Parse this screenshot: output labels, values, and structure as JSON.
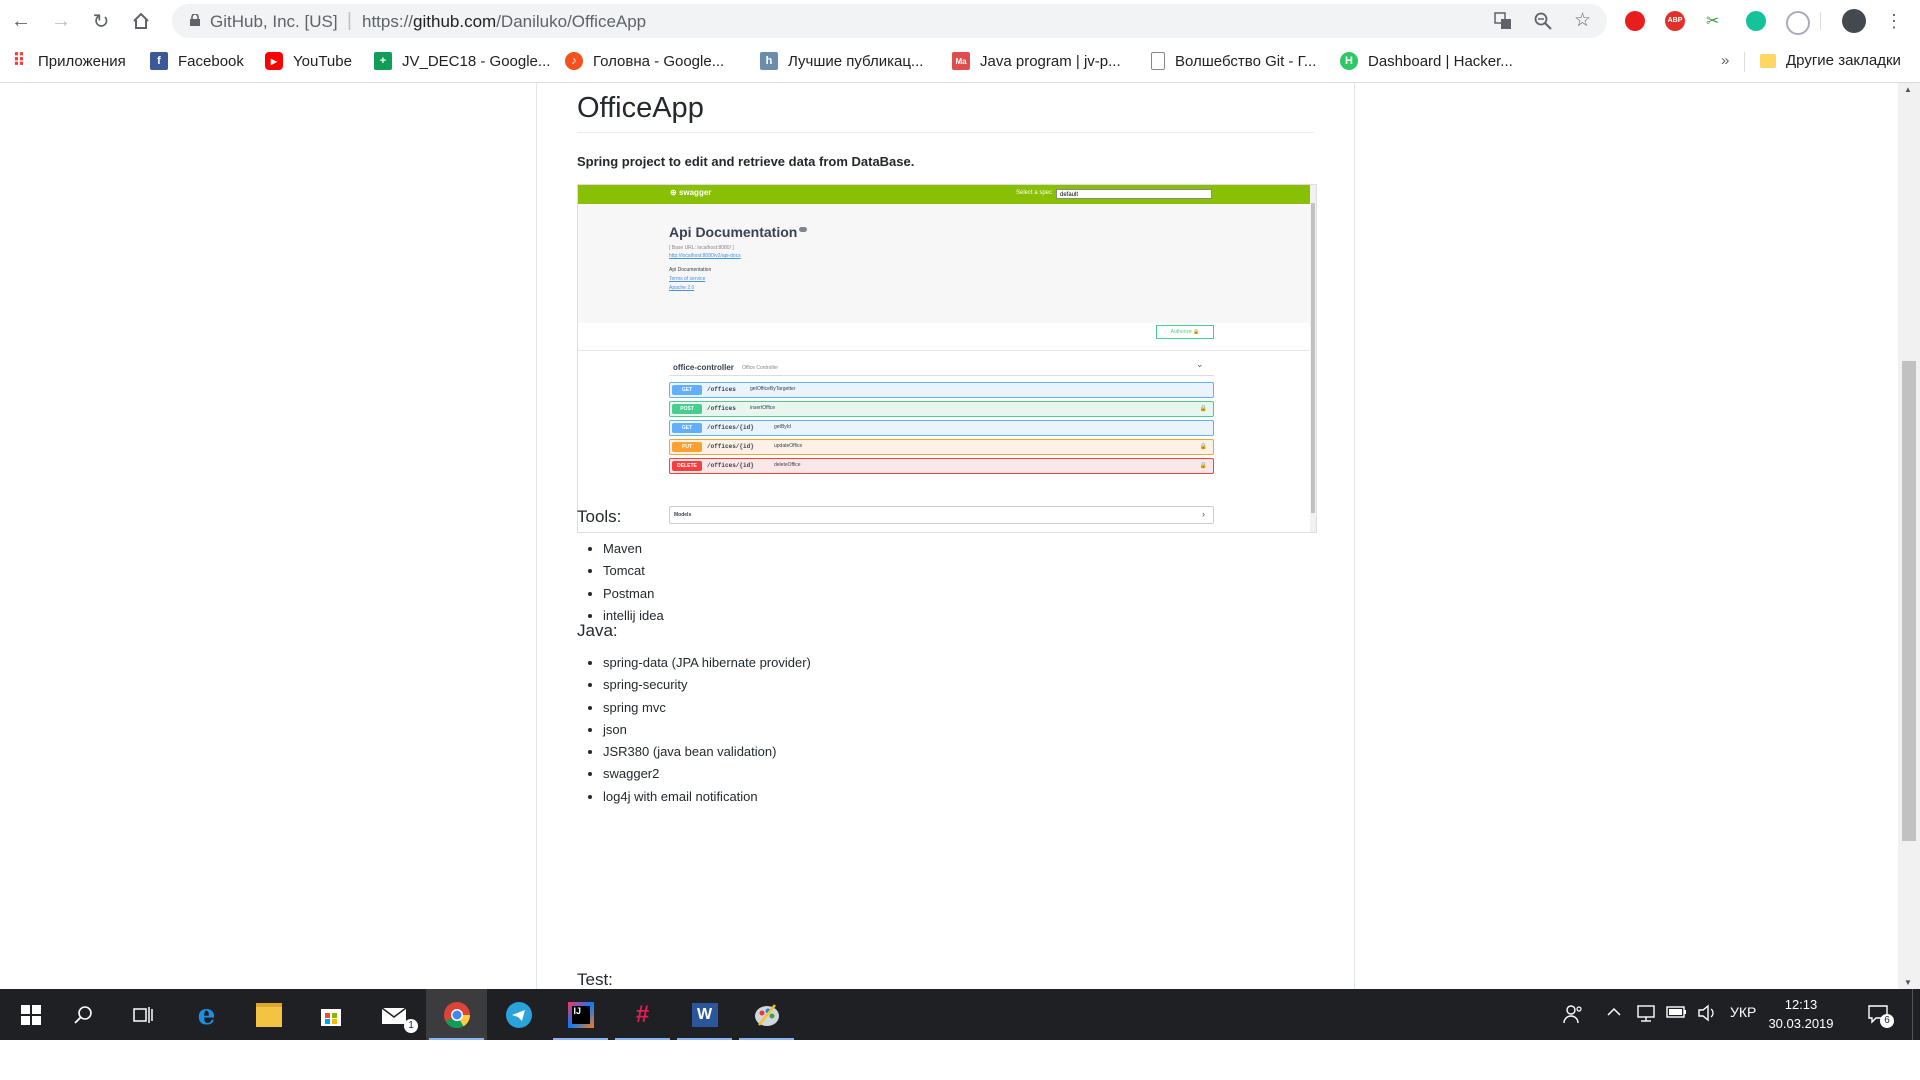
{
  "browser": {
    "site_identity": "GitHub, Inc. [US]",
    "url_prefix": "https://",
    "url_host": "github.com",
    "url_path": "/Daniluko/OfficeApp",
    "bookmarks": [
      {
        "label": "Приложения",
        "icon": "apps-grid-icon",
        "color": "#ea4335"
      },
      {
        "label": "Facebook",
        "icon": "facebook-icon",
        "color": "#3b5998"
      },
      {
        "label": "YouTube",
        "icon": "youtube-icon",
        "color": "#ff0000"
      },
      {
        "label": "JV_DEC18 - Google...",
        "icon": "google-sheets-icon",
        "color": "#0f9d58"
      },
      {
        "label": "Головна - Google...",
        "icon": "google-site-icon",
        "color": "#f4511e"
      },
      {
        "label": "Лучшие публикац...",
        "icon": "habr-icon",
        "color": "#6b8cab"
      },
      {
        "label": "Java program | jv-p...",
        "icon": "mate-icon",
        "color": "#e04b4b"
      },
      {
        "label": "Волшебство Git - Г...",
        "icon": "page-icon",
        "color": "#888888"
      },
      {
        "label": "Dashboard | Hacker...",
        "icon": "hackerrank-icon",
        "color": "#2ec866"
      }
    ],
    "more_bookmarks": "»",
    "other_bookmarks": "Другие закладки"
  },
  "readme": {
    "title": "OfficeApp",
    "description": "Spring project to edit and retrieve data from DataBase.",
    "swagger": {
      "logo": "swagger",
      "select_label": "Select a spec",
      "select_value": "default",
      "title": "Api Documentation",
      "base_url": "[ Base URL: localhost:8080/ ]",
      "docs_link": "http://localhost:8080/v2/api-docs",
      "info_text": "Api Documentation",
      "terms_link": "Terms of service",
      "license_link": "Apache 2.0",
      "authorize": "Authorize",
      "controller": "office-controller",
      "controller_desc": "Office Controller",
      "operations": [
        {
          "method": "GET",
          "path": "/offices",
          "summary": "getOfficeByTargetter",
          "color": "#61affe",
          "bg": "#ebf3fb",
          "locked": false
        },
        {
          "method": "POST",
          "path": "/offices",
          "summary": "insertOffice",
          "color": "#49cc90",
          "bg": "#e8f6f0",
          "locked": true
        },
        {
          "method": "GET",
          "path": "/offices/{id}",
          "summary": "getById",
          "color": "#61affe",
          "bg": "#ebf3fb",
          "locked": false
        },
        {
          "method": "PUT",
          "path": "/offices/{id}",
          "summary": "updateOffice",
          "color": "#fca130",
          "bg": "#fbf1e6",
          "locked": true
        },
        {
          "method": "DELETE",
          "path": "/offices/{id}",
          "summary": "deleteOffice",
          "color": "#f93e3e",
          "bg": "#fae7e7",
          "locked": true
        }
      ],
      "models": "Models"
    },
    "tools_heading": "Tools:",
    "tools": [
      "Maven",
      "Tomcat",
      "Postman",
      "intellij idea"
    ],
    "java_heading": "Java:",
    "java": [
      "spring-data (JPA hibernate provider)",
      "spring-security",
      "spring mvc",
      "json",
      "JSR380 (java bean validation)",
      "swagger2",
      "log4j with email notification"
    ],
    "test_heading": "Test:"
  },
  "taskbar": {
    "apps": [
      "start-icon",
      "search-icon",
      "task-view-icon",
      "edge-icon",
      "file-explorer-icon",
      "store-icon",
      "mail-icon",
      "chrome-icon",
      "telegram-icon",
      "intellij-icon",
      "slack-icon",
      "word-icon",
      "paint-icon"
    ],
    "mail_badge": "1",
    "language": "УКР",
    "time": "12:13",
    "date": "30.03.2019",
    "notifications": "6"
  }
}
